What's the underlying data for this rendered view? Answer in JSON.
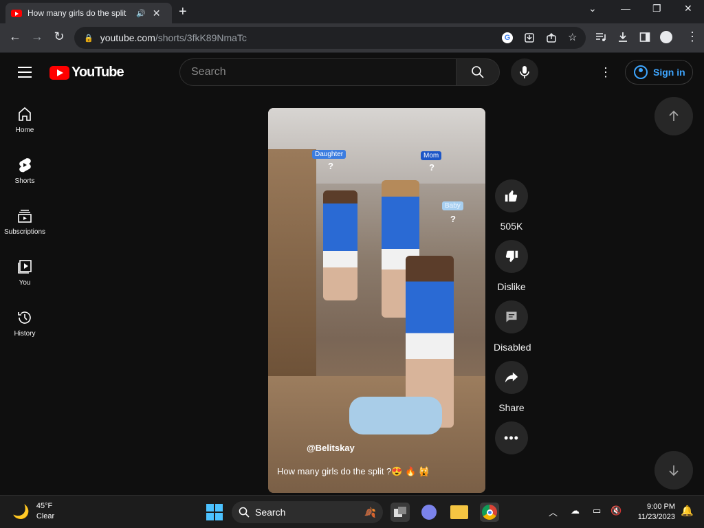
{
  "browser": {
    "tab_title": "How many girls do the split",
    "url_host": "youtube.com",
    "url_path": "/shorts/3fkK89NmaTc",
    "icons": {
      "back": "back-arrow-icon",
      "forward": "forward-arrow-icon",
      "reload": "reload-icon",
      "lock": "lock-icon",
      "star": "bookmark-star-icon"
    }
  },
  "header": {
    "logo_text": "YouTube",
    "search_placeholder": "Search",
    "sign_in_label": "Sign in"
  },
  "sidebar": {
    "items": [
      {
        "label": "Home",
        "icon": "home-icon"
      },
      {
        "label": "Shorts",
        "icon": "shorts-icon"
      },
      {
        "label": "Subscriptions",
        "icon": "subscriptions-icon"
      },
      {
        "label": "You",
        "icon": "you-icon"
      },
      {
        "label": "History",
        "icon": "history-icon"
      }
    ]
  },
  "short": {
    "overlay_tags": [
      {
        "text": "Daughter",
        "q": "?"
      },
      {
        "text": "Mom",
        "q": "?"
      },
      {
        "text": "Baby",
        "q": "?"
      }
    ],
    "channel": "@Belitskay",
    "caption": "How many girls do the split ?😍 🔥 🙀"
  },
  "actions": {
    "like_count": "505K",
    "dislike_label": "Dislike",
    "comments_label": "Disabled",
    "share_label": "Share"
  },
  "taskbar": {
    "weather_temp": "45°F",
    "weather_desc": "Clear",
    "search_label": "Search",
    "time": "9:00 PM",
    "date": "11/23/2023"
  },
  "colors": {
    "brand_red": "#ff0000",
    "link_blue": "#3ea6ff",
    "page_bg": "#0f0f0f"
  }
}
